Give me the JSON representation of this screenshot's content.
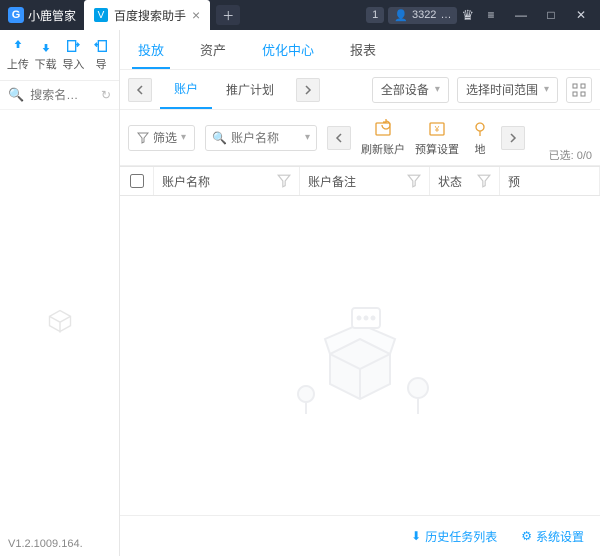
{
  "titlebar": {
    "app_name": "小鹿管家",
    "tab_title": "百度搜索助手",
    "notif_count": "1",
    "user_id": "3322",
    "user_suffix": "…"
  },
  "sidebar": {
    "tool_upload": "上传",
    "tool_download": "下载",
    "tool_import": "导入",
    "tool_export": "导",
    "search_placeholder": "搜索名…",
    "version": "V1.2.1009.164."
  },
  "maintabs": {
    "t0": "投放",
    "t1": "资产",
    "t2": "优化中心",
    "t3": "报表"
  },
  "subtabs": {
    "t0": "账户",
    "t1": "推广计划"
  },
  "selectors": {
    "device": "全部设备",
    "timerange": "选择时间范围"
  },
  "toolbar": {
    "filter": "筛选",
    "account_search_placeholder": "账户名称",
    "refresh_account": "刷新账户",
    "budget_setting": "预算设置",
    "geo": "地",
    "selected_label": "已选:",
    "selected_count": "0/0"
  },
  "columns": {
    "name": "账户名称",
    "note": "账户备注",
    "status": "状态",
    "budget": "预"
  },
  "footer": {
    "history": "历史任务列表",
    "settings": "系统设置"
  }
}
